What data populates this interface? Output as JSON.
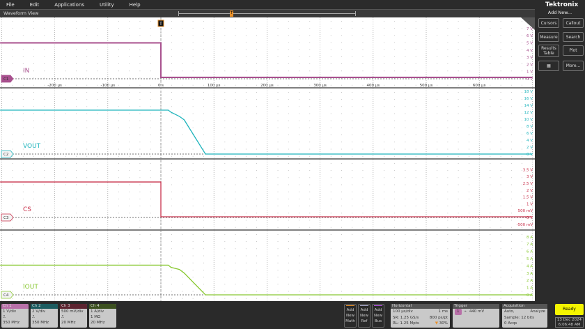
{
  "menu": [
    "File",
    "Edit",
    "Applications",
    "Utility",
    "Help"
  ],
  "view_title": "Waveform View",
  "trigger_marker": "T",
  "brand": "Tektronix",
  "right_panel": {
    "add_new": "Add New...",
    "buttons": [
      "Cursors",
      "Callout",
      "Measure",
      "Search",
      "Results Table",
      "Plot",
      "More..."
    ],
    "icon": "zoom-grid-icon"
  },
  "time_axis": {
    "labels": [
      "-200 µs",
      "-100 µs",
      "0 s",
      "100 µs",
      "200 µs",
      "300 µs",
      "400 µs",
      "500 µs",
      "600 µs"
    ],
    "values_us": [
      -200,
      -100,
      0,
      100,
      200,
      300,
      400,
      500,
      600
    ]
  },
  "channels": [
    {
      "id": "C1",
      "label": "IN",
      "color": "#a8508e",
      "axis": [
        "7 V",
        "6 V",
        "5 V",
        "4 V",
        "3 V",
        "2 V",
        "1 V",
        "0 V"
      ],
      "axis_values": [
        7,
        6,
        5,
        4,
        3,
        2,
        1,
        0
      ],
      "waveform": [
        [
          -303,
          5
        ],
        [
          0,
          5
        ],
        [
          0,
          0.2
        ],
        [
          700,
          0.2
        ]
      ]
    },
    {
      "id": "C2",
      "label": "VOUT",
      "color": "#1eb4bc",
      "axis": [
        "18 V",
        "16 V",
        "14 V",
        "12 V",
        "10 V",
        "8 V",
        "6 V",
        "4 V",
        "2 V",
        "0 V"
      ],
      "axis_values": [
        18,
        16,
        14,
        12,
        10,
        8,
        6,
        4,
        2,
        0
      ],
      "waveform": [
        [
          -303,
          12.6
        ],
        [
          14,
          12.6
        ],
        [
          19,
          12
        ],
        [
          35,
          10.8
        ],
        [
          44,
          9.8
        ],
        [
          84,
          0
        ],
        [
          700,
          0
        ]
      ]
    },
    {
      "id": "C3",
      "label": "CS",
      "color": "#c8304a",
      "axis": [
        "3.5 V",
        "3 V",
        "2.5 V",
        "2 V",
        "1.5 V",
        "1 V",
        "500 mV",
        "0 V",
        "-500 mV"
      ],
      "axis_values": [
        3.5,
        3,
        2.5,
        2,
        1.5,
        1,
        0.5,
        0,
        -0.5
      ],
      "waveform": [
        [
          -303,
          2.6
        ],
        [
          0,
          2.6
        ],
        [
          0,
          0.05
        ],
        [
          700,
          0.05
        ]
      ]
    },
    {
      "id": "C4",
      "label": "IOUT",
      "color": "#88c830",
      "axis": [
        "8 A",
        "7 A",
        "6 A",
        "5 A",
        "4 A",
        "3 A",
        "2 A",
        "1 A",
        "0 A"
      ],
      "axis_values": [
        8,
        7,
        6,
        5,
        4,
        3,
        2,
        1,
        0
      ],
      "waveform": [
        [
          -303,
          4.1
        ],
        [
          14,
          4.1
        ],
        [
          19,
          3.8
        ],
        [
          35,
          3.5
        ],
        [
          44,
          3
        ],
        [
          84,
          0
        ],
        [
          700,
          0
        ]
      ]
    }
  ],
  "ch_boxes": [
    {
      "title": "Ch 1",
      "lines": [
        "1 V/div",
        "⎍",
        "350 MHz"
      ],
      "color": "#b870a8"
    },
    {
      "title": "Ch 2",
      "lines": [
        "2 V/div",
        "⎍",
        "350 MHz"
      ],
      "color": "#1c5c60"
    },
    {
      "title": "Ch 3",
      "lines": [
        "500 mV/div",
        "⎍",
        "20 MHz"
      ],
      "color": "#5c2430"
    },
    {
      "title": "Ch 4",
      "lines": [
        "1 A/div",
        "1 MΩ",
        "20 MHz"
      ],
      "color": "#3c5020"
    }
  ],
  "add_buttons": [
    {
      "label": "Add New Math",
      "color": "#e8902a"
    },
    {
      "label": "Add New Ref",
      "color": "#aaaacc"
    },
    {
      "label": "Add New Bus",
      "color": "#b050e0"
    }
  ],
  "horizontal": {
    "title": "Horizontal",
    "rows": [
      [
        "100 µs/div",
        "1 ms"
      ],
      [
        "SR: 1.25 GS/s",
        "800 ps/pt"
      ],
      [
        "RL: 1.25 Mpts",
        "30%"
      ]
    ]
  },
  "trigger": {
    "title": "Trigger",
    "source": "1",
    "level": "440 mV"
  },
  "acquisition": {
    "title": "Acquisition",
    "rows": [
      [
        "Auto,",
        "Analyze"
      ],
      [
        "Sample: 12 bits",
        ""
      ],
      [
        "0 Acqs",
        ""
      ]
    ]
  },
  "status": "Ready",
  "date": "13 Dec 2024",
  "time": "6:06:48 AM"
}
